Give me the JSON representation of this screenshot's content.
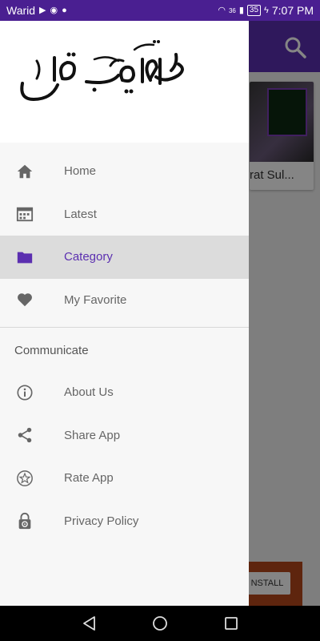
{
  "status_bar": {
    "carrier": "Warid",
    "network": "36",
    "battery": "35",
    "time": "7:07 PM"
  },
  "background": {
    "card_title": "rat Sul...",
    "install_label": "NSTALL"
  },
  "drawer": {
    "menu_items": [
      {
        "label": "Home",
        "icon": "home-icon"
      },
      {
        "label": "Latest",
        "icon": "calendar-icon"
      },
      {
        "label": "Category",
        "icon": "folder-icon",
        "selected": true
      },
      {
        "label": "My Favorite",
        "icon": "heart-icon"
      }
    ],
    "section_title": "Communicate",
    "communicate_items": [
      {
        "label": "About Us",
        "icon": "info-icon"
      },
      {
        "label": "Share App",
        "icon": "share-icon"
      },
      {
        "label": "Rate App",
        "icon": "star-icon"
      },
      {
        "label": "Privacy Policy",
        "icon": "lock-icon"
      }
    ]
  },
  "colors": {
    "accent": "#5b2fb0",
    "status_bar": "#4a1f91",
    "selected_bg": "#dcdcdc"
  }
}
